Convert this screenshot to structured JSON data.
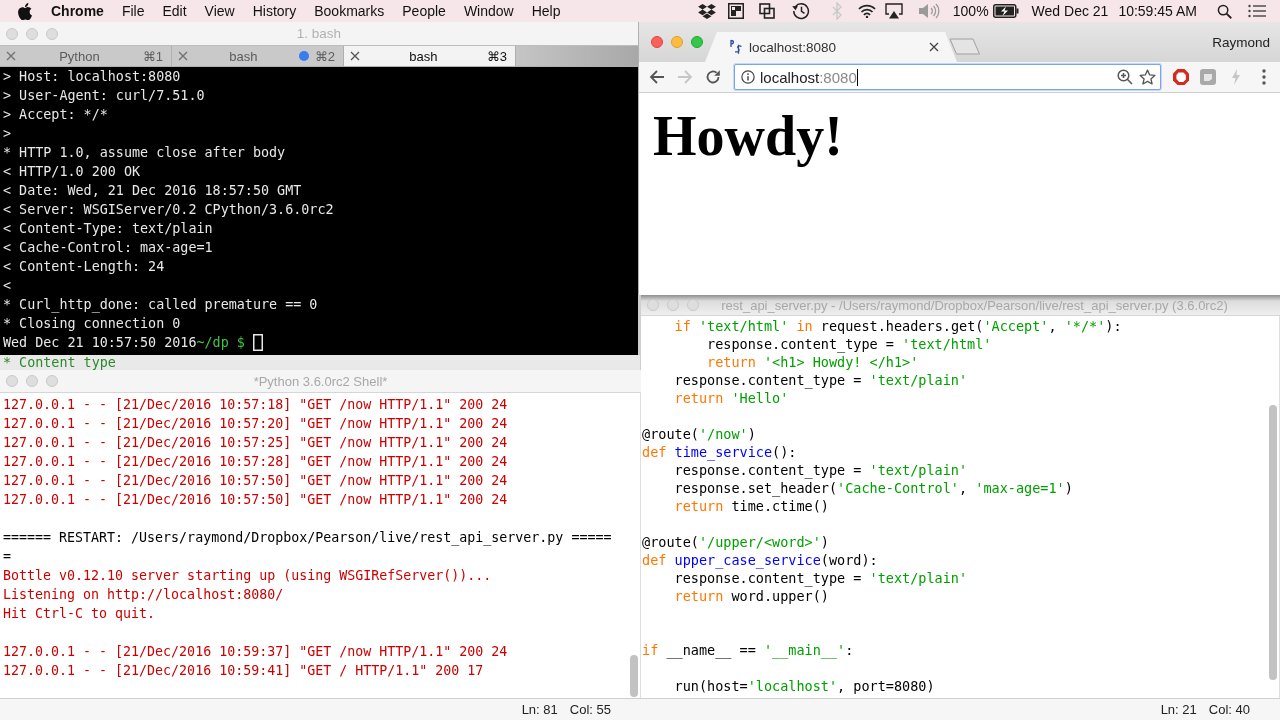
{
  "menu_bar": {
    "app_name": "Chrome",
    "menus": [
      "File",
      "Edit",
      "View",
      "History",
      "Bookmarks",
      "People",
      "Window",
      "Help"
    ],
    "bluetooth_on": false,
    "battery_percent": "100%",
    "date": "Wed Dec 21",
    "time": "10:59:45 AM"
  },
  "terminal": {
    "title": "1. bash",
    "active": false,
    "tabs": [
      {
        "label": "Python",
        "shortcut": "⌘1",
        "selected": false,
        "activity": false
      },
      {
        "label": "bash",
        "shortcut": "⌘2",
        "selected": false,
        "activity": true
      },
      {
        "label": "bash",
        "shortcut": "⌘3",
        "selected": true,
        "activity": false
      }
    ],
    "lines": [
      "> Host: localhost:8080",
      "> User-Agent: curl/7.51.0",
      "> Accept: */*",
      ">",
      "* HTTP 1.0, assume close after body",
      "< HTTP/1.0 200 OK",
      "< Date: Wed, 21 Dec 2016 18:57:50 GMT",
      "< Server: WSGIServer/0.2 CPython/3.6.0rc2",
      "< Content-Type: text/plain",
      "< Cache-Control: max-age=1",
      "< Content-Length: 24",
      "<",
      "* Curl_http_done: called premature == 0",
      "* Closing connection 0"
    ],
    "prompt": {
      "timestamp": "Wed Dec 21 10:57:50 2016",
      "path": "~/dp $"
    }
  },
  "browser": {
    "active": true,
    "tab": {
      "title": "localhost:8080"
    },
    "profile": "Raymond",
    "navigation": {
      "back_enabled": true,
      "forward_enabled": false
    },
    "address": {
      "host": "localhost",
      "port": ":8080"
    },
    "page_heading": "Howdy!"
  },
  "background_window": {
    "line": "* Content type"
  },
  "shell": {
    "title": "*Python 3.6.0rc2 Shell*",
    "active": false,
    "lines": [
      {
        "kind": "stderr",
        "text": "127.0.0.1 - - [21/Dec/2016 10:57:18] \"GET /now HTTP/1.1\" 200 24"
      },
      {
        "kind": "stderr",
        "text": "127.0.0.1 - - [21/Dec/2016 10:57:20] \"GET /now HTTP/1.1\" 200 24"
      },
      {
        "kind": "stderr",
        "text": "127.0.0.1 - - [21/Dec/2016 10:57:25] \"GET /now HTTP/1.1\" 200 24"
      },
      {
        "kind": "stderr",
        "text": "127.0.0.1 - - [21/Dec/2016 10:57:28] \"GET /now HTTP/1.1\" 200 24"
      },
      {
        "kind": "stderr",
        "text": "127.0.0.1 - - [21/Dec/2016 10:57:50] \"GET /now HTTP/1.1\" 200 24"
      },
      {
        "kind": "stderr",
        "text": "127.0.0.1 - - [21/Dec/2016 10:57:50] \"GET /now HTTP/1.1\" 200 24"
      },
      {
        "kind": "blank"
      },
      {
        "kind": "banner",
        "text": "====== RESTART: /Users/raymond/Dropbox/Pearson/live/rest_api_server.py ====="
      },
      {
        "kind": "banner",
        "text": "="
      },
      {
        "kind": "stderr",
        "text": "Bottle v0.12.10 server starting up (using WSGIRefServer())..."
      },
      {
        "kind": "stderr",
        "text": "Listening on http://localhost:8080/"
      },
      {
        "kind": "stderr",
        "text": "Hit Ctrl-C to quit."
      },
      {
        "kind": "blank"
      },
      {
        "kind": "stderr",
        "text": "127.0.0.1 - - [21/Dec/2016 10:59:37] \"GET /now HTTP/1.1\" 200 24"
      },
      {
        "kind": "stderr",
        "text": "127.0.0.1 - - [21/Dec/2016 10:59:41] \"GET / HTTP/1.1\" 200 17"
      }
    ],
    "status": {
      "line": "Ln: 81",
      "column": "Col: 55"
    }
  },
  "editor": {
    "title": "rest_api_server.py - /Users/raymond/Dropbox/Pearson/live/rest_api_server.py (3.6.0rc2)",
    "active": false,
    "lines": [
      {
        "kind": "code",
        "tokens": [
          {
            "kind": "keyword",
            "text": "    if"
          },
          {
            "kind": "string",
            "text": " 'text/html'"
          },
          {
            "kind": "keyword",
            "text": " in"
          },
          {
            "kind": "plain",
            "text": " request.headers.get("
          },
          {
            "kind": "string",
            "text": "'Accept'"
          },
          {
            "kind": "plain",
            "text": ", "
          },
          {
            "kind": "string",
            "text": "'*/*'"
          },
          {
            "kind": "plain",
            "text": "):"
          }
        ]
      },
      {
        "kind": "code",
        "tokens": [
          {
            "kind": "plain",
            "text": "        response.content_type = "
          },
          {
            "kind": "string",
            "text": "'text/html'"
          }
        ]
      },
      {
        "kind": "code",
        "tokens": [
          {
            "kind": "keyword",
            "text": "        return"
          },
          {
            "kind": "string",
            "text": " '<h1> Howdy! </h1>'"
          }
        ]
      },
      {
        "kind": "code",
        "tokens": [
          {
            "kind": "plain",
            "text": "    response.content_type = "
          },
          {
            "kind": "string",
            "text": "'text/plain'"
          }
        ]
      },
      {
        "kind": "code",
        "tokens": [
          {
            "kind": "keyword",
            "text": "    return"
          },
          {
            "kind": "string",
            "text": " 'Hello'"
          }
        ]
      },
      {
        "kind": "blank"
      },
      {
        "kind": "code",
        "tokens": [
          {
            "kind": "plain",
            "text": "@route("
          },
          {
            "kind": "string",
            "text": "'/now'"
          },
          {
            "kind": "plain",
            "text": ")"
          }
        ]
      },
      {
        "kind": "code",
        "tokens": [
          {
            "kind": "keyword",
            "text": "def"
          },
          {
            "kind": "definition",
            "text": " time_service"
          },
          {
            "kind": "plain",
            "text": "():"
          }
        ]
      },
      {
        "kind": "code",
        "tokens": [
          {
            "kind": "plain",
            "text": "    response.content_type = "
          },
          {
            "kind": "string",
            "text": "'text/plain'"
          }
        ]
      },
      {
        "kind": "code",
        "tokens": [
          {
            "kind": "plain",
            "text": "    response.set_header("
          },
          {
            "kind": "string",
            "text": "'Cache-Control'"
          },
          {
            "kind": "plain",
            "text": ", "
          },
          {
            "kind": "string",
            "text": "'max-age=1'"
          },
          {
            "kind": "plain",
            "text": ")"
          }
        ]
      },
      {
        "kind": "code",
        "tokens": [
          {
            "kind": "keyword",
            "text": "    return"
          },
          {
            "kind": "plain",
            "text": " time.ctime()"
          }
        ]
      },
      {
        "kind": "blank"
      },
      {
        "kind": "code",
        "tokens": [
          {
            "kind": "plain",
            "text": "@route("
          },
          {
            "kind": "string",
            "text": "'/upper/<word>'"
          },
          {
            "kind": "plain",
            "text": ")"
          }
        ]
      },
      {
        "kind": "code",
        "tokens": [
          {
            "kind": "keyword",
            "text": "def"
          },
          {
            "kind": "definition",
            "text": " upper_case_service"
          },
          {
            "kind": "plain",
            "text": "(word):"
          }
        ]
      },
      {
        "kind": "code",
        "tokens": [
          {
            "kind": "plain",
            "text": "    response.content_type = "
          },
          {
            "kind": "string",
            "text": "'text/plain'"
          }
        ]
      },
      {
        "kind": "code",
        "tokens": [
          {
            "kind": "keyword",
            "text": "    return"
          },
          {
            "kind": "plain",
            "text": " word.upper()"
          }
        ]
      },
      {
        "kind": "blank"
      },
      {
        "kind": "blank"
      },
      {
        "kind": "code",
        "tokens": [
          {
            "kind": "keyword",
            "text": "if"
          },
          {
            "kind": "plain",
            "text": " __name__ == "
          },
          {
            "kind": "string",
            "text": "'__main__'"
          },
          {
            "kind": "plain",
            "text": ":"
          }
        ]
      },
      {
        "kind": "blank"
      },
      {
        "kind": "code",
        "tokens": [
          {
            "kind": "plain",
            "text": "    run(host="
          },
          {
            "kind": "string",
            "text": "'localhost'"
          },
          {
            "kind": "plain",
            "text": ", port=8080)"
          }
        ]
      }
    ],
    "status": {
      "line": "Ln: 21",
      "column": "Col: 40"
    }
  }
}
